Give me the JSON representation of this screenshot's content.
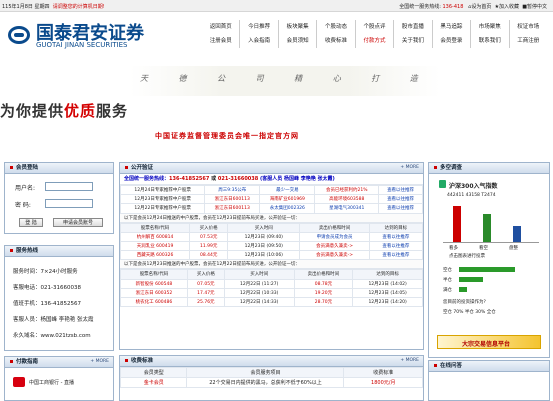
{
  "topbar": {
    "date": "115年1月8日 星期四",
    "notice": "请调整您的计算机日期!",
    "hotline_label": "全国统一服务热线:",
    "hotline_num": "136-418",
    "items": [
      "设为首页",
      "加入收藏",
      "暂停中文"
    ]
  },
  "logo": {
    "cn": "国泰君安证券",
    "en": "GUOTAI JINAN SECURITIES"
  },
  "nav": {
    "row1": [
      "返回首页",
      "今日推荐",
      "板块聚集",
      "个股动态",
      "个股点评",
      "股市直播",
      "黑马追踪",
      "市场聚焦",
      "权证市场"
    ],
    "row2": [
      "注册会员",
      "入会指南",
      "会员须知",
      "收费标准",
      "付款方式",
      "关于我们",
      "会员登录",
      "联系我们",
      "工商注册"
    ]
  },
  "banner": {
    "ads": "天 德 公 司 精 心 打 造",
    "slogan_a": "为你提供",
    "slogan_b": "优质",
    "slogan_c": "服务",
    "redline": "中国证券监督管理委员会唯一指定官方网"
  },
  "login": {
    "title": "会员登陆",
    "user_label": "用户名:",
    "pwd_label": "密  码:",
    "login_btn": "登 陆",
    "apply_btn": "申请会员账号"
  },
  "hotline": {
    "title": "服务热线",
    "lines": [
      "服务时间：7×24小时服务",
      "客服电话：021-31660038",
      "值班手机：136-41852567",
      "客服人员：杨国峰 李艳艳 张太霞",
      "永久域名：www.021tzsb.com"
    ]
  },
  "pay": {
    "title": "付款指南",
    "more": "+ MORE",
    "bank": "中国工商银行 - 直播"
  },
  "pub": {
    "title": "公开验证",
    "more": "+ MORE",
    "hot_a": "全国统一服务热线：",
    "hot_b": "136-41852567",
    "hot_c": "或",
    "hot_d": "021-31660038",
    "hot_e": "(客服人员 杨国峰 李艳艳 张太霞)",
    "rec": [
      [
        "12月24日专家推荐中户股票",
        "周三9:35公布",
        "最少一交易",
        "会员已经获利约21%",
        "查看以往推荐"
      ],
      [
        "12月23日专家推荐中户股票",
        "浙江东日600113",
        "海南矿业601969",
        "高能环境603588",
        "查看以往推荐"
      ],
      [
        "12月22日专家推荐中户股票",
        "浙江东日600113",
        "永太集团002326",
        "星湖电气300341",
        "查看以往推荐"
      ]
    ],
    "sec1_note": "以下是会员12月24日推送的中户股票，会员在12月23日提前布局买进，公开验证一切：",
    "sec2_note": "以下是会员12月23日推送的中户股票，会员在12月22日提前布局买进，公开验证一切：",
    "headers": [
      "股票名称/代码",
      "买入价格",
      "买入时间",
      "卖出价格和时间",
      "达到的目标"
    ],
    "rows1": [
      [
        "杭州解百 600814",
        "07.53元",
        "12月23日 (09:40)",
        "申请会员成为会员",
        "查看以往推荐"
      ],
      [
        "天润乳业 600419",
        "11.99元",
        "12月23日 (09:50)",
        "会员满意久兼卖->",
        "查看以往推荐"
      ],
      [
        "西藏天路 600326",
        "08.44元",
        "12月23日 (10:06)",
        "会员满意久兼卖->",
        "查看以往推荐"
      ]
    ],
    "rows2": [
      [
        "新智股份 600548",
        "07.05元",
        "12月22日 (11:27)",
        "08.78元",
        "12月23日 (14:02)"
      ],
      [
        "浙江东日 600352",
        "17.47元",
        "12月22日 (10:33)",
        "19.20元",
        "12月23日 (14:05)"
      ],
      [
        "桃农化工 600486",
        "25.76元",
        "12月22日 (14:33)",
        "28.70元",
        "12月23日 (14:20)"
      ]
    ]
  },
  "fee": {
    "title": "收费标准",
    "more": "+ MORE",
    "headers": [
      "会员类型",
      "会员服务项目",
      "收费标准"
    ],
    "row": [
      "金卡会员",
      "22个交易日内提供的黑马，总获利不低于60%以上",
      "1800元/月"
    ]
  },
  "poll": {
    "title": "多空调查",
    "ptitle": "沪深300入气指数",
    "pnums": "442411 43158 T2474",
    "b1": "看多",
    "b2": "看空",
    "b3": "盘整",
    "p1": "点击图表进行投票",
    "opts": [
      "空仓",
      "半仓",
      "满仓"
    ],
    "note": "您目前的投资操作为?",
    "pcts": "空仓 70% 半仓 30% 全仓"
  },
  "online": {
    "title": "在线问答",
    "banner": "大宗交易信息平台"
  }
}
